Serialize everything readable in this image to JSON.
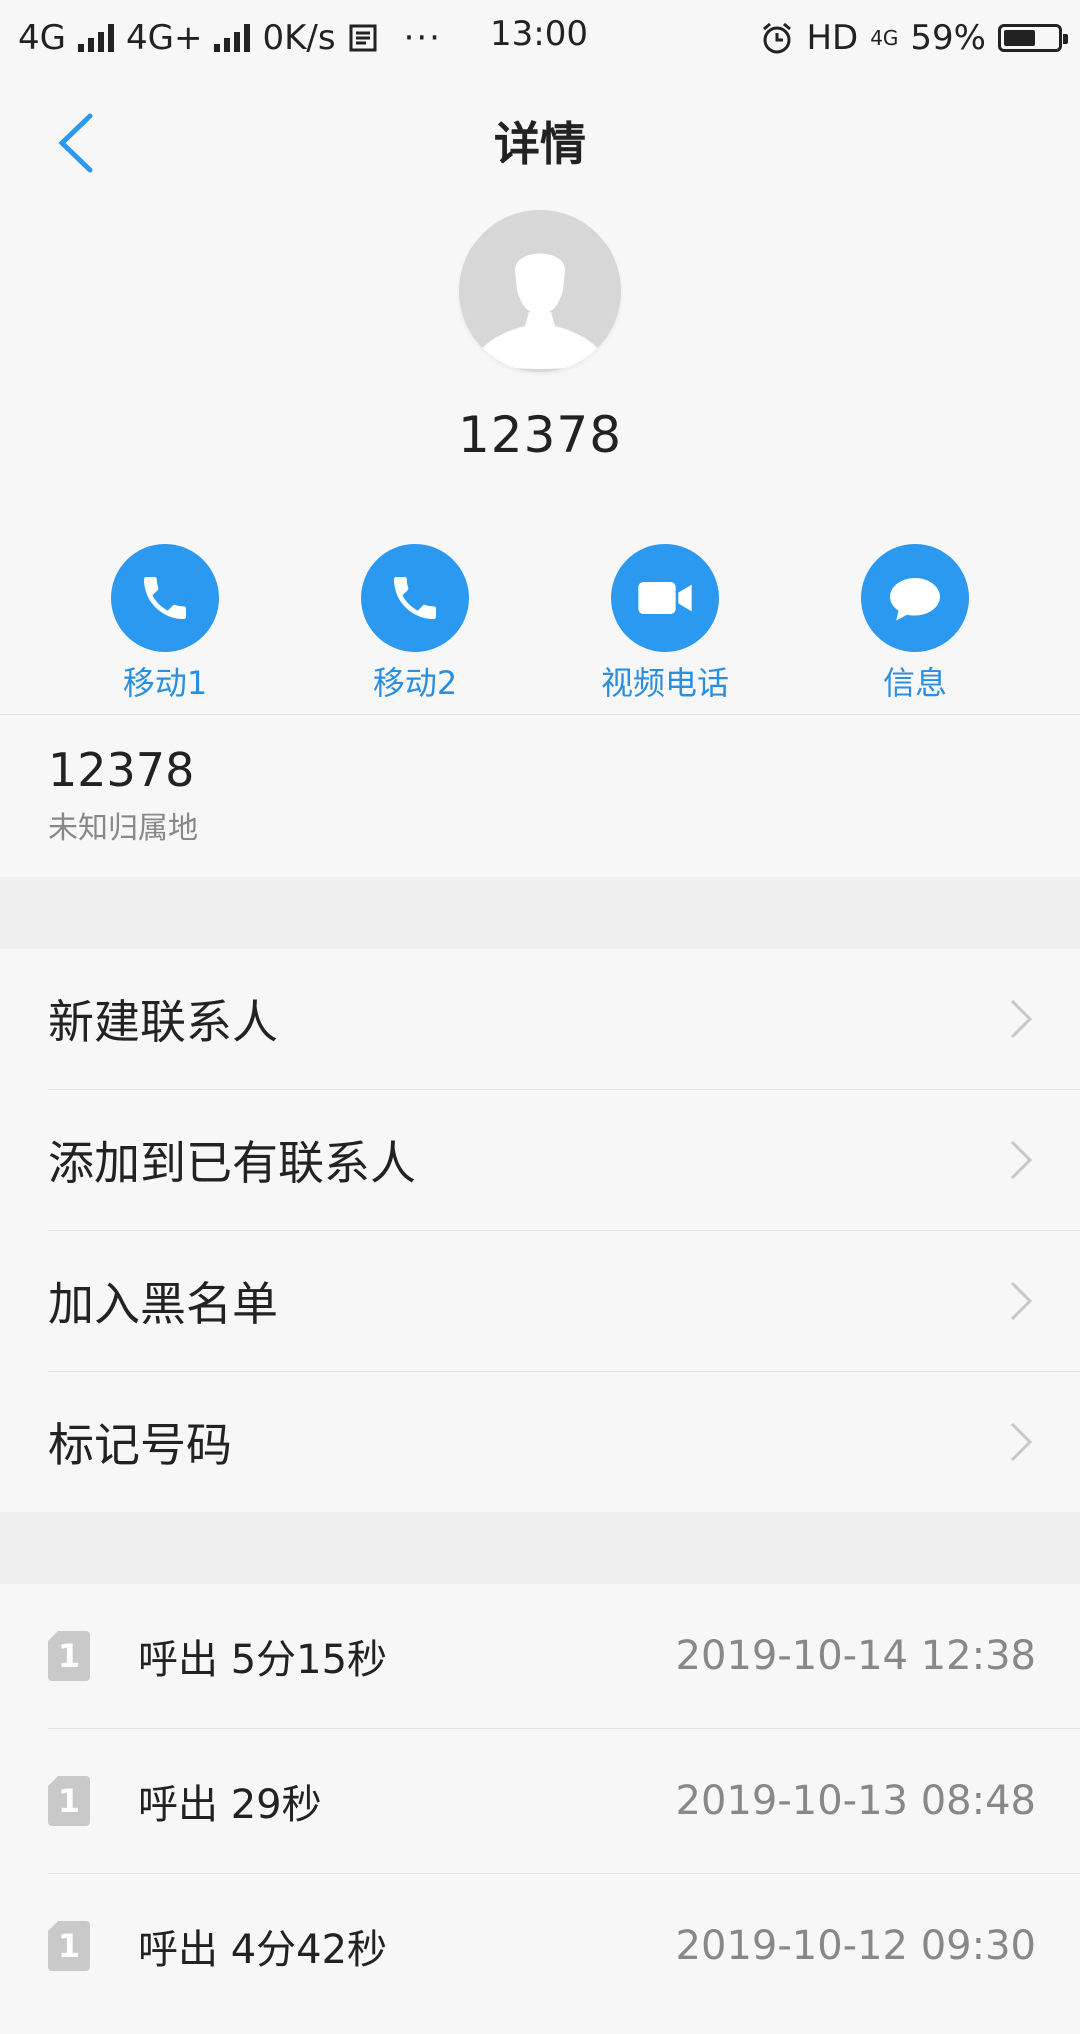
{
  "status": {
    "net1": "4G",
    "net2": "4G+",
    "speed": "0K/s",
    "time": "13:00",
    "hd": "HD",
    "net3": "4G",
    "battery": "59%",
    "battery_level": 0.59
  },
  "header": {
    "title": "详情"
  },
  "contact": {
    "number": "12378"
  },
  "actions": [
    {
      "label": "移动1",
      "icon": "phone-icon"
    },
    {
      "label": "移动2",
      "icon": "phone-icon"
    },
    {
      "label": "视频电话",
      "icon": "video-camera-icon"
    },
    {
      "label": "信息",
      "icon": "chat-bubble-icon"
    }
  ],
  "info": {
    "number": "12378",
    "location": "未知归属地"
  },
  "menu": [
    {
      "label": "新建联系人"
    },
    {
      "label": "添加到已有联系人"
    },
    {
      "label": "加入黑名单"
    },
    {
      "label": "标记号码"
    }
  ],
  "calls": [
    {
      "sim": "1",
      "type": "呼出 5分15秒",
      "time": "2019-10-14 12:38"
    },
    {
      "sim": "1",
      "type": "呼出 29秒",
      "time": "2019-10-13 08:48"
    },
    {
      "sim": "1",
      "type": "呼出 4分42秒",
      "time": "2019-10-12 09:30"
    }
  ],
  "colors": {
    "accent": "#2b99f0",
    "label_blue": "#2b8fe0"
  }
}
